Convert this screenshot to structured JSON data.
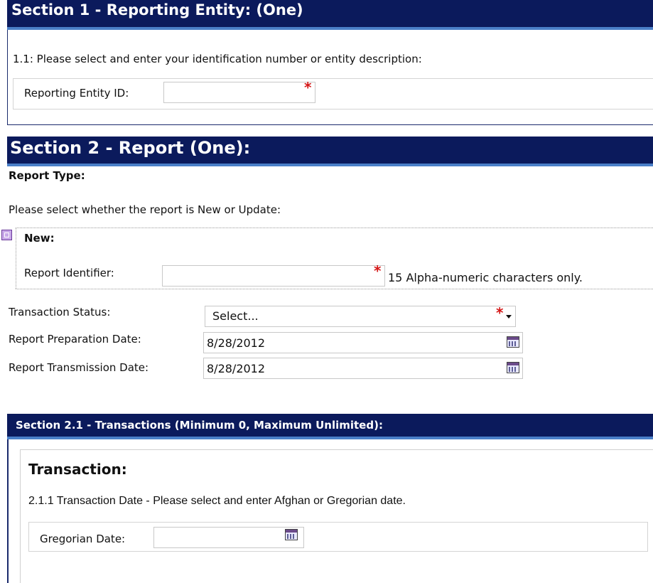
{
  "section1": {
    "title": "Section 1 - Reporting Entity: (One)",
    "instruction": "1.1: Please select and enter your identification number or entity description:",
    "entity_id_label": "Reporting Entity ID:",
    "entity_id_value": "",
    "required_mark": "*"
  },
  "section2": {
    "title": "Section 2 - Report (One):",
    "report_type_label": "Report Type:",
    "instruction": "Please select whether the report is New or Update:",
    "new_label": "New:",
    "report_identifier_label": "Report Identifier:",
    "report_identifier_value": "",
    "report_identifier_hint": "15 Alpha-numeric characters only.",
    "transaction_status_label": "Transaction Status:",
    "transaction_status_value": "Select...",
    "prep_date_label": "Report Preparation Date:",
    "prep_date_value": "8/28/2012",
    "trans_date_label": "Report Transmission Date:",
    "trans_date_value": "8/28/2012",
    "required_mark": "*"
  },
  "section21": {
    "title": "Section 2.1 - Transactions (Minimum 0, Maximum Unlimited):",
    "transaction_heading": "Transaction:",
    "date_instruction": "2.1.1 Transaction Date - Please select and enter Afghan or Gregorian date.",
    "gregorian_label": "Gregorian Date:",
    "gregorian_value": ""
  },
  "icons": {
    "toggle": "collapse-toggle-icon",
    "calendar": "calendar-icon",
    "dropdown": "chevron-down-icon"
  },
  "colors": {
    "header_bg": "#0b1a5c",
    "header_stripe": "#4a7fc8",
    "required": "#d41515"
  }
}
